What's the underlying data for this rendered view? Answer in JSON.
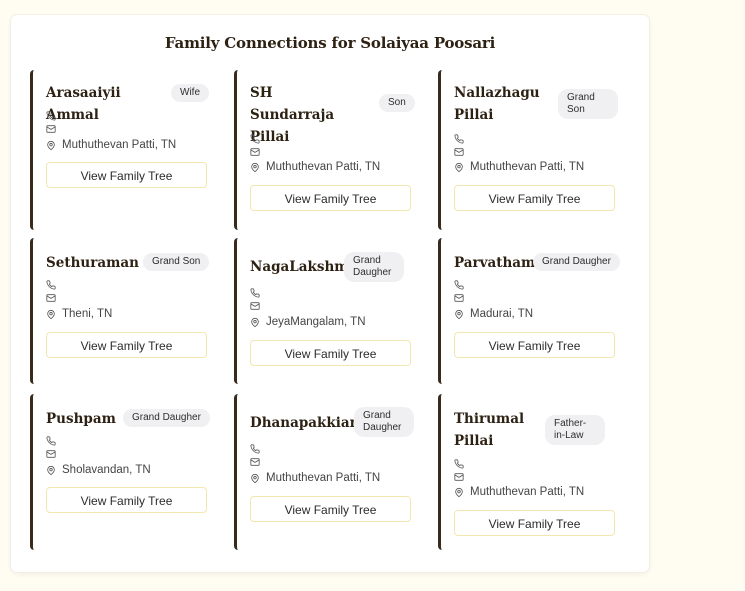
{
  "page": {
    "title": "Family Connections for Solaiyaa Poosari"
  },
  "cards": [
    {
      "name": "Arasaaiyii Ammal",
      "relation": "Wife",
      "location": "Muthuthevan Patti, TN",
      "button": "View Family Tree"
    },
    {
      "name": "SH Sundarraja Pillai",
      "relation": "Son",
      "location": "Muthuthevan Patti, TN",
      "button": "View Family Tree"
    },
    {
      "name": "Nallazhagu Pillai",
      "relation": "Grand Son",
      "location": "Muthuthevan Patti, TN",
      "button": "View Family Tree"
    },
    {
      "name": "Sethuraman",
      "relation": "Grand Son",
      "location": "Theni, TN",
      "button": "View Family Tree"
    },
    {
      "name": "NagaLakshmi",
      "relation": "Grand Daugher",
      "location": "JeyaMangalam, TN",
      "button": "View Family Tree"
    },
    {
      "name": "Parvatham",
      "relation": "Grand Daugher",
      "location": "Madurai, TN",
      "button": "View Family Tree"
    },
    {
      "name": "Pushpam",
      "relation": "Grand Daugher",
      "location": "Sholavandan, TN",
      "button": "View Family Tree"
    },
    {
      "name": "Dhanapakkiam",
      "relation": "Grand Daugher",
      "location": "Muthuthevan Patti, TN",
      "button": "View Family Tree"
    },
    {
      "name": "Thirumal Pillai",
      "relation": "Father-in-Law",
      "location": "Muthuthevan Patti, TN",
      "button": "View Family Tree"
    }
  ],
  "icons": {
    "phone": "phone-icon",
    "email": "mail-icon",
    "location": "map-pin-icon"
  }
}
